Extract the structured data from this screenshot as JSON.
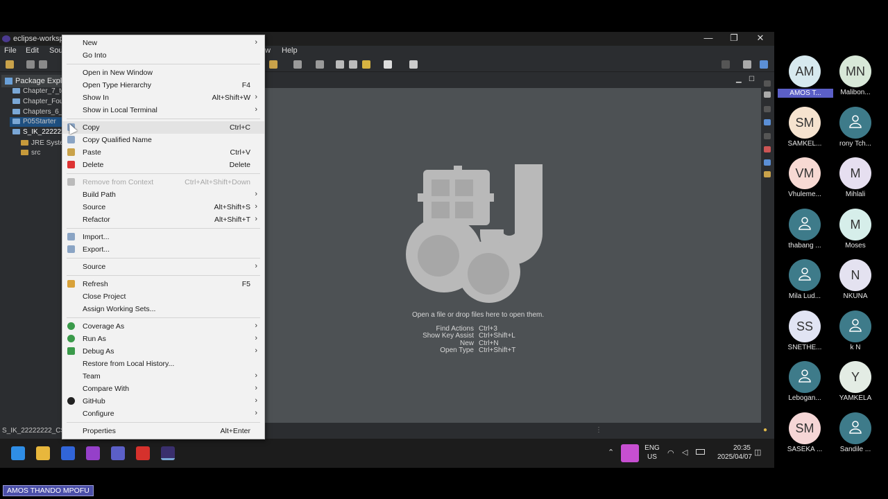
{
  "window": {
    "title": "eclipse-workspa",
    "controls": [
      "—",
      "❐",
      "✕"
    ]
  },
  "menubar": {
    "items": [
      "File",
      "Edit",
      "Sou",
      "w",
      "Help"
    ]
  },
  "explorer": {
    "tab_label": "Package Explore",
    "items": [
      {
        "label": "Chapter_7_to",
        "indent": 0
      },
      {
        "label": "Chapter_Fou",
        "indent": 0
      },
      {
        "label": "Chapters_6_t",
        "indent": 0
      },
      {
        "label": "P05Starter",
        "indent": 0
      },
      {
        "label": "S_IK_2222222",
        "indent": 0,
        "selected": true
      },
      {
        "label": "JRE Syster",
        "indent": 1
      },
      {
        "label": "src",
        "indent": 1
      }
    ]
  },
  "editor": {
    "drop_hint": "Open a file or drop files here to open them.",
    "shortcuts": [
      {
        "action": "Find Actions",
        "keys": "Ctrl+3"
      },
      {
        "action": "Show Key Assist",
        "keys": "Ctrl+Shift+L"
      },
      {
        "action": "New",
        "keys": "Ctrl+N"
      },
      {
        "action": "Open Type",
        "keys": "Ctrl+Shift+T"
      }
    ]
  },
  "statusbar": {
    "text": "S_IK_22222222_CSC2"
  },
  "context_menu": {
    "items": [
      {
        "label": "New",
        "submenu": true
      },
      {
        "label": "Go Into"
      },
      {
        "separator": true
      },
      {
        "label": "Open in New Window"
      },
      {
        "label": "Open Type Hierarchy",
        "shortcut": "F4"
      },
      {
        "label": "Show In",
        "shortcut": "Alt+Shift+W",
        "submenu": true
      },
      {
        "label": "Show in Local Terminal",
        "submenu": true
      },
      {
        "separator": true
      },
      {
        "label": "Copy",
        "shortcut": "Ctrl+C",
        "icon": "copy-icon",
        "hover": true
      },
      {
        "label": "Copy Qualified Name",
        "icon": "copy-qualified-name-icon"
      },
      {
        "label": "Paste",
        "shortcut": "Ctrl+V",
        "icon": "paste-icon"
      },
      {
        "label": "Delete",
        "shortcut": "Delete",
        "icon": "delete-icon"
      },
      {
        "separator": true
      },
      {
        "label": "Remove from Context",
        "shortcut": "Ctrl+Alt+Shift+Down",
        "disabled": true,
        "icon": "remove-from-context-icon"
      },
      {
        "label": "Build Path",
        "submenu": true
      },
      {
        "label": "Source",
        "shortcut": "Alt+Shift+S",
        "submenu": true
      },
      {
        "label": "Refactor",
        "shortcut": "Alt+Shift+T",
        "submenu": true
      },
      {
        "separator": true
      },
      {
        "label": "Import...",
        "icon": "import-icon"
      },
      {
        "label": "Export...",
        "icon": "export-icon"
      },
      {
        "separator": true
      },
      {
        "label": "Source",
        "submenu": true
      },
      {
        "separator": true
      },
      {
        "label": "Refresh",
        "shortcut": "F5",
        "icon": "refresh-icon"
      },
      {
        "label": "Close Project"
      },
      {
        "label": "Assign Working Sets..."
      },
      {
        "separator": true
      },
      {
        "label": "Coverage As",
        "submenu": true,
        "icon": "coverage-icon"
      },
      {
        "label": "Run As",
        "submenu": true,
        "icon": "run-icon"
      },
      {
        "label": "Debug As",
        "submenu": true,
        "icon": "debug-icon"
      },
      {
        "label": "Restore from Local History..."
      },
      {
        "label": "Team",
        "submenu": true
      },
      {
        "label": "Compare With",
        "submenu": true
      },
      {
        "label": "GitHub",
        "submenu": true,
        "icon": "github-icon"
      },
      {
        "label": "Configure",
        "submenu": true
      },
      {
        "separator": true
      },
      {
        "label": "Properties",
        "shortcut": "Alt+Enter"
      }
    ]
  },
  "taskbar": {
    "language": "ENG",
    "region": "US",
    "time": "20:35",
    "date": "2025/04/07"
  },
  "participants": [
    {
      "initials": "AM",
      "name": "AMOS T...",
      "color": "#d7e9ef",
      "active": true
    },
    {
      "initials": "MN",
      "name": "Malibon...",
      "color": "#d8e8d8"
    },
    {
      "initials": "SM",
      "name": "SAMKEL...",
      "color": "#f6e3cf"
    },
    {
      "initials": "",
      "name": "rony Tch...",
      "color": "#3e7b8a",
      "generic": true
    },
    {
      "initials": "VM",
      "name": "Vhuleme...",
      "color": "#f7d9d3"
    },
    {
      "initials": "M",
      "name": "Mihlali",
      "color": "#e6dff0"
    },
    {
      "initials": "",
      "name": "thabang ...",
      "color": "#3e7b8a",
      "generic": true
    },
    {
      "initials": "M",
      "name": "Moses",
      "color": "#d6eeea"
    },
    {
      "initials": "",
      "name": "Mila Lud...",
      "color": "#3e7b8a",
      "generic": true
    },
    {
      "initials": "N",
      "name": "NKUNA",
      "color": "#e4e2f0"
    },
    {
      "initials": "SS",
      "name": "SNETHE...",
      "color": "#e1e4f3"
    },
    {
      "initials": "",
      "name": "k N",
      "color": "#3e7b8a",
      "generic": true
    },
    {
      "initials": "",
      "name": "Lebogan...",
      "color": "#3e7b8a",
      "generic": true
    },
    {
      "initials": "Y",
      "name": "YAMKELA",
      "color": "#e3ece4"
    },
    {
      "initials": "SM",
      "name": "SASEKA ...",
      "color": "#f5d6d6"
    },
    {
      "initials": "",
      "name": "Sandile ...",
      "color": "#3e7b8a",
      "generic": true
    }
  ],
  "speaker": {
    "name": "AMOS THANDO MPOFU"
  }
}
